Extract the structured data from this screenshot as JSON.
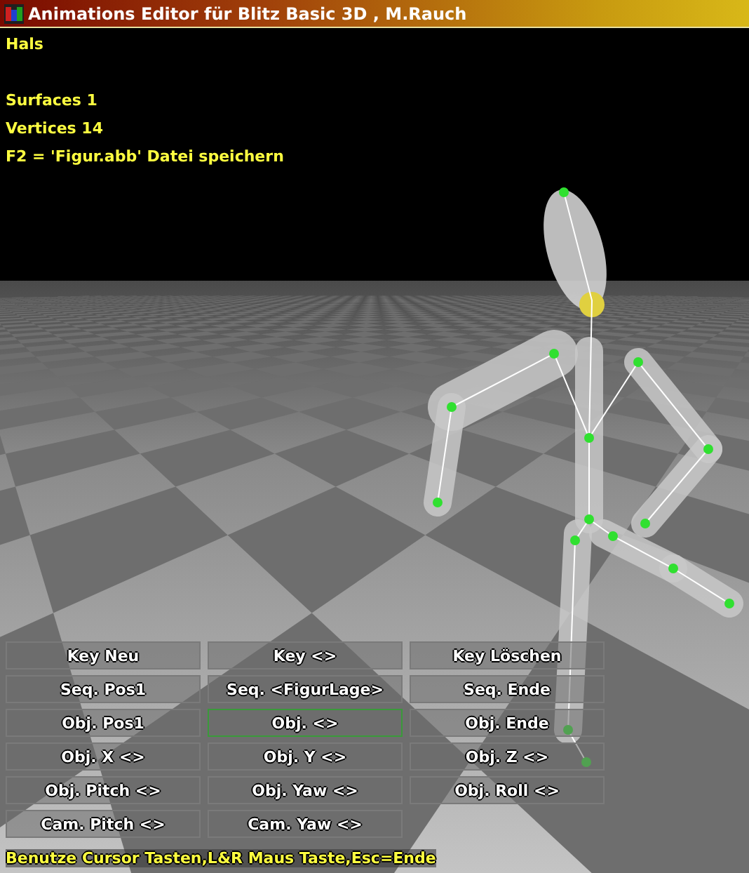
{
  "window": {
    "title": "Animations Editor für Blitz Basic 3D , M.Rauch"
  },
  "object_name": "Hals",
  "info": [
    "Surfaces 1",
    "Vertices 14",
    "F2 = 'Figur.abb' Datei speichern"
  ],
  "buttons": [
    [
      {
        "label": "Key Neu",
        "selected": false
      },
      {
        "label": "Key <>",
        "selected": false
      },
      {
        "label": "Key Löschen",
        "selected": false
      }
    ],
    [
      {
        "label": "Seq. Pos1",
        "selected": false
      },
      {
        "label": "Seq. <FigurLage>",
        "selected": false
      },
      {
        "label": "Seq. Ende",
        "selected": false
      }
    ],
    [
      {
        "label": "Obj. Pos1",
        "selected": false
      },
      {
        "label": "Obj. <>",
        "selected": true
      },
      {
        "label": "Obj. Ende",
        "selected": false
      }
    ],
    [
      {
        "label": "Obj. X <>",
        "selected": false
      },
      {
        "label": "Obj. Y <>",
        "selected": false
      },
      {
        "label": "Obj. Z <>",
        "selected": false
      }
    ],
    [
      {
        "label": "Obj. Pitch <>",
        "selected": false
      },
      {
        "label": "Obj. Yaw <>",
        "selected": false
      },
      {
        "label": "Obj. Roll <>",
        "selected": false
      }
    ],
    [
      {
        "label": "Cam. Pitch <>",
        "selected": false
      },
      {
        "label": "Cam. Yaw <>",
        "selected": false
      }
    ]
  ],
  "footer": "Benutze Cursor Tasten,L&R Maus Taste,Esc=Ende"
}
